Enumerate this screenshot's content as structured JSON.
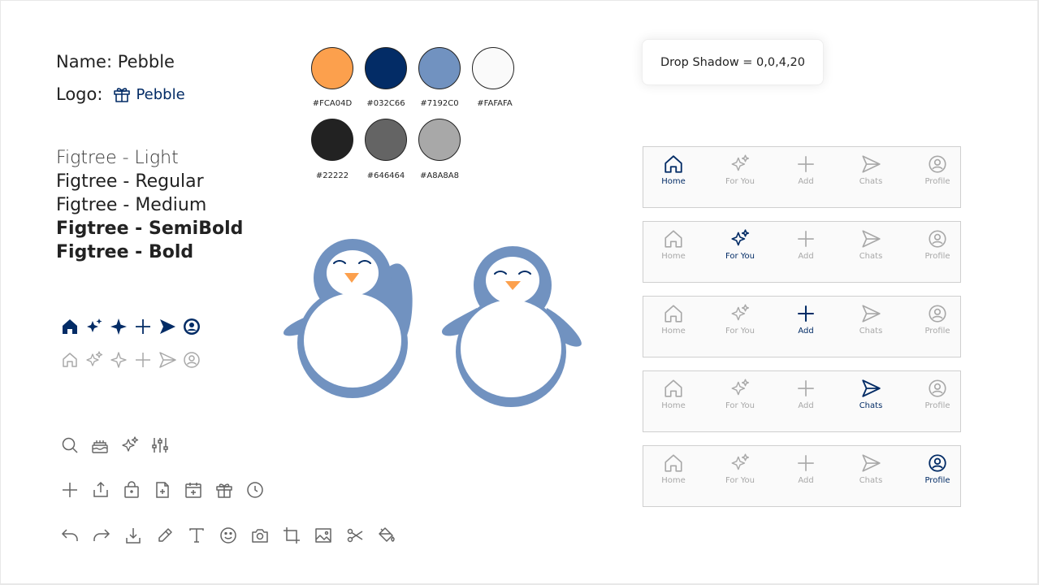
{
  "brand": {
    "name_line": "Name: Pebble",
    "logo_label": "Logo:",
    "logo_name": "Pebble",
    "logo_icon": "gift-icon"
  },
  "fonts": [
    "Figtree - Light",
    "Figtree - Regular",
    "Figtree - Medium",
    "Figtree - SemiBold",
    "Figtree - Bold"
  ],
  "palette": [
    {
      "label": "#FCA04D",
      "color": "#FCA04D"
    },
    {
      "label": "#032C66",
      "color": "#032C66"
    },
    {
      "label": "#7192C0",
      "color": "#7192C0"
    },
    {
      "label": "#FAFAFA",
      "color": "#FAFAFA"
    },
    {
      "label": "#22222",
      "color": "#222222"
    },
    {
      "label": "#646464",
      "color": "#646464"
    },
    {
      "label": "#A8A8A8",
      "color": "#A8A8A8"
    }
  ],
  "shadow_note": "Drop Shadow = 0,0,4,20",
  "nav_icons_filled": [
    "home-icon",
    "sparkles-icon",
    "star-icon",
    "plus-icon",
    "send-icon",
    "profile-icon"
  ],
  "nav_icons_outline": [
    "home-icon",
    "sparkles-icon",
    "star-icon",
    "plus-icon",
    "send-icon",
    "profile-icon"
  ],
  "utility_icons_row1": [
    "search-icon",
    "cake-icon",
    "sparkles-icon",
    "sliders-icon"
  ],
  "utility_icons_row2": [
    "plus-icon",
    "share-icon",
    "bag-icon",
    "file-add-icon",
    "calendar-add-icon",
    "gift-icon",
    "clock-icon"
  ],
  "utility_icons_row3": [
    "undo-icon",
    "redo-icon",
    "download-icon",
    "pencil-icon",
    "text-icon",
    "emoji-icon",
    "camera-icon",
    "crop-icon",
    "image-icon",
    "scissors-icon",
    "paint-bucket-icon"
  ],
  "mascots": [
    "penguin-waving",
    "penguin-standing"
  ],
  "nav_labels": [
    "Home",
    "For You",
    "Add",
    "Chats",
    "Profile"
  ],
  "navbars": [
    {
      "active": "Home"
    },
    {
      "active": "For You"
    },
    {
      "active": "Add"
    },
    {
      "active": "Chats"
    },
    {
      "active": "Profile"
    }
  ],
  "colors": {
    "active": "#032C66",
    "inactive": "#A8A8A8",
    "mascot": "#7192C0",
    "beak": "#FCA04D"
  }
}
